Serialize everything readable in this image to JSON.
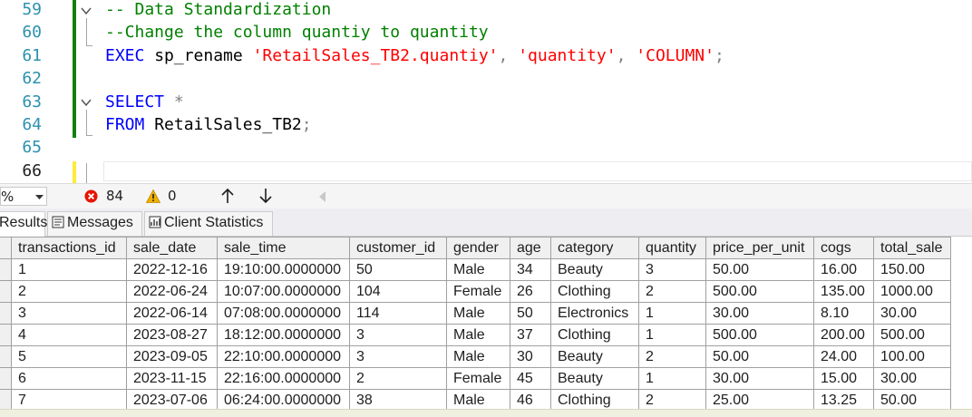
{
  "editor": {
    "line_numbers": [
      "59",
      "60",
      "61",
      "62",
      "63",
      "64",
      "65",
      "66"
    ],
    "lines": [
      [
        {
          "t": "cmt",
          "v": "-- Data Standardization"
        }
      ],
      [
        {
          "t": "cmt",
          "v": "--Change the column quantiy to quantity"
        }
      ],
      [
        {
          "t": "kw",
          "v": "EXEC"
        },
        {
          "t": "id",
          "v": " sp_rename "
        },
        {
          "t": "str",
          "v": "'RetailSales_TB2.quantiy'"
        },
        {
          "t": "gr",
          "v": ", "
        },
        {
          "t": "str",
          "v": "'quantity'"
        },
        {
          "t": "gr",
          "v": ", "
        },
        {
          "t": "str",
          "v": "'COLUMN'"
        },
        {
          "t": "gr",
          "v": ";"
        }
      ],
      [],
      [
        {
          "t": "kw",
          "v": "SELECT"
        },
        {
          "t": "id",
          "v": " "
        },
        {
          "t": "gr",
          "v": "*"
        }
      ],
      [
        {
          "t": "kw",
          "v": "FROM"
        },
        {
          "t": "id",
          "v": " RetailSales_TB2"
        },
        {
          "t": "gr",
          "v": ";"
        }
      ],
      [],
      []
    ]
  },
  "status": {
    "zoom": "%",
    "errors": "84",
    "warnings": "0"
  },
  "tabs": [
    {
      "label": "Results",
      "icon": "results-grid-icon"
    },
    {
      "label": "Messages",
      "icon": "messages-icon"
    },
    {
      "label": "Client Statistics",
      "icon": "client-statistics-icon"
    }
  ],
  "grid": {
    "columns": [
      "transactions_id",
      "sale_date",
      "sale_time",
      "customer_id",
      "gender",
      "age",
      "category",
      "quantity",
      "price_per_unit",
      "cogs",
      "total_sale"
    ],
    "rows": [
      [
        "1",
        "2022-12-16",
        "19:10:00.0000000",
        "50",
        "Male",
        "34",
        "Beauty",
        "3",
        "50.00",
        "16.00",
        "150.00"
      ],
      [
        "2",
        "2022-06-24",
        "10:07:00.0000000",
        "104",
        "Female",
        "26",
        "Clothing",
        "2",
        "500.00",
        "135.00",
        "1000.00"
      ],
      [
        "3",
        "2022-06-14",
        "07:08:00.0000000",
        "114",
        "Male",
        "50",
        "Electronics",
        "1",
        "30.00",
        "8.10",
        "30.00"
      ],
      [
        "4",
        "2023-08-27",
        "18:12:00.0000000",
        "3",
        "Male",
        "37",
        "Clothing",
        "1",
        "500.00",
        "200.00",
        "500.00"
      ],
      [
        "5",
        "2023-09-05",
        "22:10:00.0000000",
        "3",
        "Male",
        "30",
        "Beauty",
        "2",
        "50.00",
        "24.00",
        "100.00"
      ],
      [
        "6",
        "2023-11-15",
        "22:16:00.0000000",
        "2",
        "Female",
        "45",
        "Beauty",
        "1",
        "30.00",
        "15.00",
        "30.00"
      ],
      [
        "7",
        "2023-07-06",
        "06:24:00.0000000",
        "38",
        "Male",
        "46",
        "Clothing",
        "2",
        "25.00",
        "13.25",
        "50.00"
      ]
    ]
  }
}
